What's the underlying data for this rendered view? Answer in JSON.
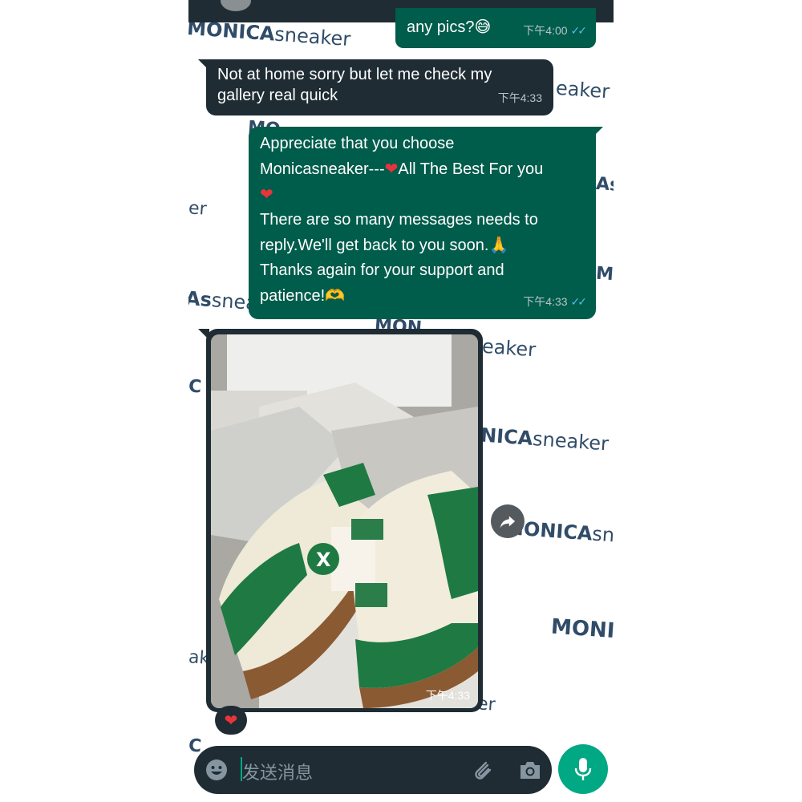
{
  "watermark": {
    "upper": "MONICA",
    "lower": "sneaker",
    "frag_er": "er",
    "frag_as": "As",
    "frag_mo": "MO",
    "frag_ak": "ak",
    "frag_c": "C",
    "frag_sneaker_s": "sneake",
    "frag_eaker": "eaker",
    "frag_nica": "NICA",
    "frag_mon": "MON",
    "frag_monic": "MONIC"
  },
  "messages": [
    {
      "id": "m0",
      "direction": "outgoing",
      "text": "any pics?",
      "emoji": "😅",
      "time": "下午4:00",
      "ticks": "✓✓"
    },
    {
      "id": "m1",
      "direction": "incoming",
      "lines": [
        "Not at home sorry but let me check my",
        "gallery real quick"
      ],
      "time": "下午4:33"
    },
    {
      "id": "m2",
      "direction": "outgoing",
      "lines": [
        "Appreciate that you choose",
        "Monicasneaker---",
        "All The Best For you",
        "There are so many messages needs to",
        "reply.We'll get back to you soon.",
        "Thanks again for your support and",
        "patience!"
      ],
      "emoji_heart": "❤",
      "emoji_pray": "🙏",
      "emoji_hands": "🫶",
      "time": "下午4:33",
      "ticks": "✓✓"
    },
    {
      "id": "m3",
      "direction": "incoming",
      "type": "image",
      "time": "下午4:33",
      "reaction": "❤"
    }
  ],
  "composer": {
    "placeholder": "发送消息",
    "emoji_icon": "emoji-icon",
    "attach_icon": "paperclip-icon",
    "camera_icon": "camera-icon",
    "mic_icon": "microphone-icon"
  },
  "colors": {
    "incoming_bubble": "#1f2c34",
    "outgoing_bubble": "#005c4b",
    "accent": "#00a884",
    "read_ticks": "#53bdeb",
    "watermark": "#1f3d5c"
  }
}
